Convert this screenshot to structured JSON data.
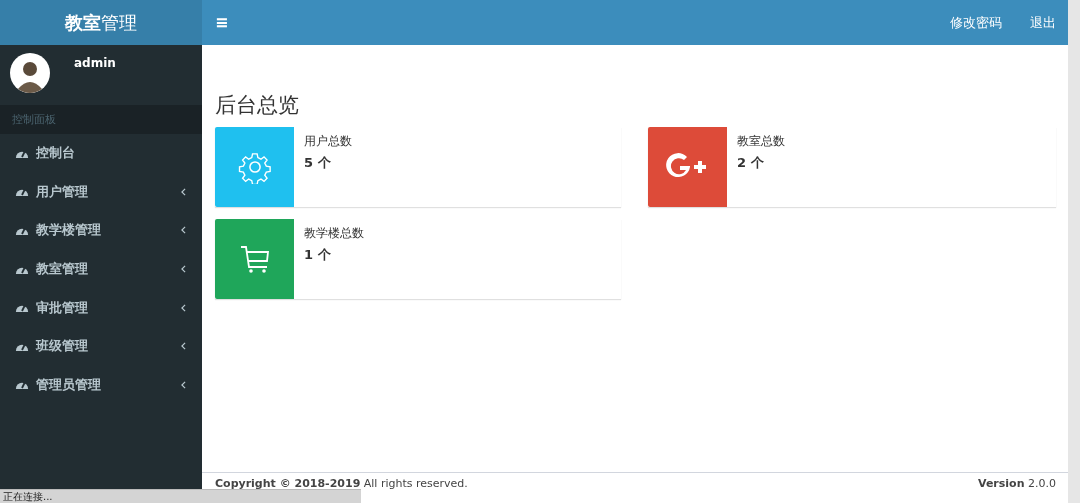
{
  "logo": "**教室**管理",
  "header": {
    "menu_icon": "≡",
    "links": [
      "修改密码",
      "退出"
    ]
  },
  "user": {
    "name": "admin"
  },
  "sidebar": {
    "section": "控制面板",
    "items": [
      {
        "label": "控制台",
        "expandable": false
      },
      {
        "label": "用户管理",
        "expandable": true
      },
      {
        "label": "教学楼管理",
        "expandable": true
      },
      {
        "label": "教室管理",
        "expandable": true
      },
      {
        "label": "审批管理",
        "expandable": true
      },
      {
        "label": "班级管理",
        "expandable": true
      },
      {
        "label": "管理员管理",
        "expandable": true
      }
    ]
  },
  "page_title": "后台总览",
  "stats": [
    {
      "label": "用户总数",
      "value": "5 个",
      "color": "#1fc0ef",
      "kind": "gear"
    },
    {
      "label": "教室总数",
      "value": "2 个",
      "color": "#dd4b39",
      "kind": "gplus"
    },
    {
      "label": "教学楼总数",
      "value": "1 个",
      "color": "#1fa65a",
      "kind": "cart"
    }
  ],
  "footer": {
    "copyright": "**Copyright © 2018-2019** All rights reserved.",
    "version": "**Version** 2.0.0"
  },
  "browser_status": "正在连接..."
}
